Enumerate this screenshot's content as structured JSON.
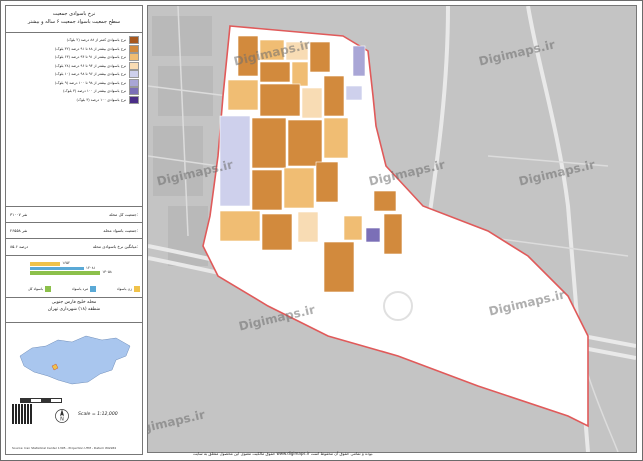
{
  "title": {
    "line1": "نرخ باسوادی جمعیت",
    "line2": "سطح جمعیت باسواد جمعیت ۶ ساله و بیشتر"
  },
  "legend": [
    {
      "label": "نرخ باسوادی کمتر از ۸۸ درصد (۲ بلوک)",
      "color": "#a7581f"
    },
    {
      "label": "نرخ باسوادی بیشتر از ۸۸ تا ۹۱ درصد (۳۲ بلوک)",
      "color": "#d28a3d"
    },
    {
      "label": "نرخ باسوادی بیشتر از ۹۱ تا ۹۴ درصد (۶۳ بلوک)",
      "color": "#f0bd73"
    },
    {
      "label": "نرخ باسوادی بیشتر از ۹۴ تا ۹۶ درصد (۲۸ بلوک)",
      "color": "#f8dcb4"
    },
    {
      "label": "نرخ باسوادی بیشتر از ۹۶ تا ۹۸ درصد (۱۰ بلوک)",
      "color": "#ced0ec"
    },
    {
      "label": "نرخ باسوادی بیشتر از ۹۸ تا ۱۰۰ درصد (۹ بلوک)",
      "color": "#a9a6d6"
    },
    {
      "label": "نرخ باسوادی بیشتر از ۱۰۰ درصد (۳ بلوک)",
      "color": "#7b6fb7"
    },
    {
      "label": "نرخ باسوادی ۱۰۰ درصد (۳ بلوک)",
      "color": "#4a2d87"
    }
  ],
  "stats": [
    {
      "label": "جمعیت کل محله:",
      "value": "۳۱۰۰۷ نفر"
    },
    {
      "label": "جمعیت باسواد محله:",
      "value": "۲۶۵۵۸ نفر"
    },
    {
      "label": "میانگین نرخ باسوادی محله:",
      "value": "۸۵.۶ درصد"
    }
  ],
  "bars": [
    {
      "label": "۱۶۵۲",
      "fraction": 0.28,
      "color": "#f0c24a"
    },
    {
      "label": "۱۲۰۸۱",
      "fraction": 0.5,
      "color": "#5aa9d6"
    },
    {
      "label": "۱۳۰۵۸",
      "fraction": 0.65,
      "color": "#8cc04b"
    }
  ],
  "bar_legend": [
    {
      "label": "باسواد کل",
      "color": "#8cc04b"
    },
    {
      "label": "مرد باسواد",
      "color": "#5aa9d6"
    },
    {
      "label": "زن باسواد",
      "color": "#f0c24a"
    }
  ],
  "region": {
    "name": "محله خلیج فارس جنوبی",
    "district": "منطقه (۱۸) شهرداری تهران"
  },
  "scale_text": "Scale = 1:12,000",
  "footer_left": "Source: Iran Statistical Center 1395 - Projection UTM - Datum WGS84",
  "credit": "حقوق مالکیت معنوی این محصول متعلق به سایت www.digimaps.ir بوده و تمامی حقوق آن محفوظ است.",
  "watermarks": [
    "Digimaps.ir",
    "Digimaps.ir",
    "Digimaps.ir",
    "Digimaps.ir",
    "Digimaps.ir",
    "Digimaps.ir",
    "Digimaps.ir",
    "Digimaps.ir"
  ],
  "map_colors": {
    "road": "#b3b3b3",
    "ground": "#c4c4c4",
    "boundary": "#e05a5a"
  }
}
